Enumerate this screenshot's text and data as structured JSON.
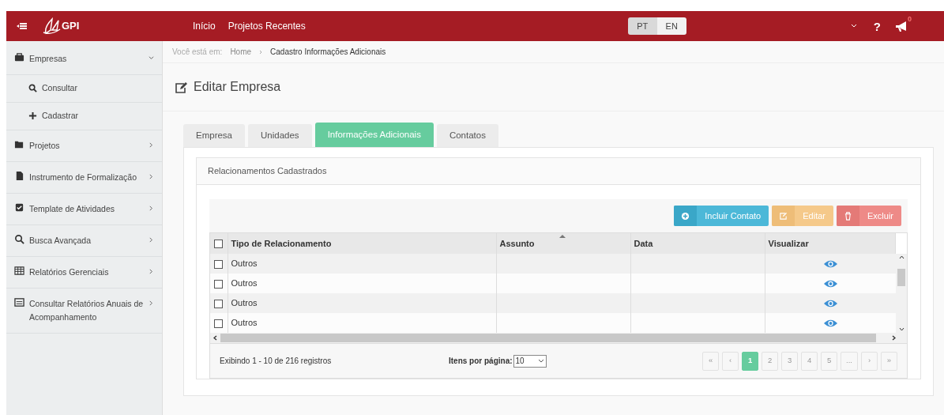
{
  "header": {
    "app_name": "GPI",
    "nav": [
      "Início",
      "Projetos Recentes"
    ],
    "languages": [
      {
        "label": "PT",
        "selected": true
      },
      {
        "label": "EN",
        "selected": false
      }
    ],
    "help_label": "?",
    "notification_count": "0"
  },
  "sidebar": {
    "items": [
      {
        "label": "Empresas",
        "expanded": true,
        "children": [
          {
            "label": "Consultar"
          },
          {
            "label": "Cadastrar"
          }
        ]
      },
      {
        "label": "Projetos",
        "expanded": false
      },
      {
        "label": "Instrumento de Formalização",
        "expanded": false
      },
      {
        "label": "Template de Atividades",
        "expanded": false
      },
      {
        "label": "Busca Avançada",
        "expanded": false
      },
      {
        "label": "Relatórios Gerenciais",
        "expanded": false
      },
      {
        "label": "Consultar Relatórios Anuais de Acompanhamento",
        "expanded": false
      }
    ]
  },
  "breadcrumb": {
    "prefix": "Você está em:",
    "items": [
      "Home",
      "Cadastro Informações Adicionais"
    ]
  },
  "page_title": "Editar Empresa",
  "tabs": [
    {
      "label": "Empresa",
      "selected": false
    },
    {
      "label": "Unidades",
      "selected": false
    },
    {
      "label": "Informações Adicionais",
      "selected": true
    },
    {
      "label": "Contatos",
      "selected": false
    }
  ],
  "panel": {
    "title": "Relacionamentos Cadastrados",
    "actions": [
      {
        "label": "Incluir Contato",
        "kind": "add"
      },
      {
        "label": "Editar",
        "kind": "edit"
      },
      {
        "label": "Excluir",
        "kind": "delete"
      }
    ],
    "table": {
      "all_checked": false,
      "columns": [
        {
          "label": "Tipo de Relacionamento",
          "sorted": false
        },
        {
          "label": "Assunto",
          "sorted": true
        },
        {
          "label": "Data",
          "sorted": false
        },
        {
          "label": "Visualizar",
          "sorted": false
        }
      ],
      "rows": [
        {
          "checked": false,
          "type": "Outros"
        },
        {
          "checked": false,
          "type": "Outros"
        },
        {
          "checked": false,
          "type": "Outros"
        },
        {
          "checked": false,
          "type": "Outros"
        }
      ]
    },
    "summary": "Exibindo 1 - 10 de 216 registros",
    "per_page_label": "Itens por página:",
    "per_page": "10",
    "pagination": [
      {
        "label": "«",
        "selected": false
      },
      {
        "label": "‹",
        "selected": false
      },
      {
        "label": "1",
        "selected": true
      },
      {
        "label": "2",
        "selected": false
      },
      {
        "label": "3",
        "selected": false
      },
      {
        "label": "4",
        "selected": false
      },
      {
        "label": "5",
        "selected": false
      },
      {
        "label": "...",
        "selected": false
      },
      {
        "label": "›",
        "selected": false
      },
      {
        "label": "»",
        "selected": false
      }
    ]
  }
}
